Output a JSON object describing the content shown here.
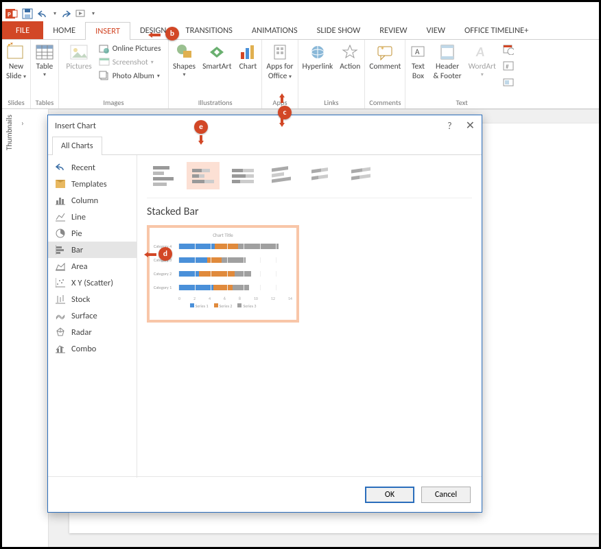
{
  "qat": {
    "save": "Save",
    "undo": "Undo",
    "redo": "Redo",
    "start": "Start"
  },
  "tabs": {
    "file": "FILE",
    "home": "HOME",
    "insert": "INSERT",
    "design": "DESIGN",
    "transitions": "TRANSITIONS",
    "animations": "ANIMATIONS",
    "slideshow": "SLIDE SHOW",
    "review": "REVIEW",
    "view": "VIEW",
    "timeline": "OFFICE TIMELINE+"
  },
  "ribbon": {
    "new_slide": "New\nSlide",
    "new_slide_l1": "New",
    "new_slide_l2": "Slide",
    "slides": "Slides",
    "table": "Table",
    "tables": "Tables",
    "pictures": "Pictures",
    "online": "Online Pictures",
    "screenshot": "Screenshot",
    "photo": "Photo Album",
    "images": "Images",
    "shapes": "Shapes",
    "smartart": "SmartArt",
    "chart": "Chart",
    "illustrations": "Illustrations",
    "apps_l1": "Apps for",
    "apps_l2": "Office",
    "apps": "Apps",
    "hyperlink": "Hyperlink",
    "action": "Action",
    "links": "Links",
    "comment": "Comment",
    "comments": "Comments",
    "textbox_l1": "Text",
    "textbox_l2": "Box",
    "header_l1": "Header",
    "header_l2": "& Footer",
    "wordart": "WordArt",
    "text": "Text"
  },
  "thumbnails": "Thumbnails",
  "dialog": {
    "title": "Insert Chart",
    "help": "?",
    "tab": "All Charts",
    "nav": {
      "recent": "Recent",
      "templates": "Templates",
      "column": "Column",
      "line": "Line",
      "pie": "Pie",
      "bar": "Bar",
      "area": "Area",
      "xy": "X Y (Scatter)",
      "stock": "Stock",
      "surface": "Surface",
      "radar": "Radar",
      "combo": "Combo"
    },
    "preview_title": "Stacked Bar",
    "ok": "OK",
    "cancel": "Cancel"
  },
  "callouts": {
    "b": "b",
    "c": "c",
    "d": "d",
    "e": "e"
  },
  "chart_data": {
    "type": "bar",
    "title": "Chart Title",
    "categories": [
      "Category 4",
      "Category 3",
      "Category 2",
      "Category 1"
    ],
    "series": [
      {
        "name": "Series 1",
        "color": "#4a90d9",
        "values_top_to_bottom": [
          4.5,
          3.5,
          2.5,
          4.3
        ]
      },
      {
        "name": "Series 2",
        "color": "#e08a3c",
        "values_top_to_bottom": [
          2.8,
          1.8,
          4.4,
          2.4
        ]
      },
      {
        "name": "Series 3",
        "color": "#a0a0a0",
        "values_top_to_bottom": [
          5.0,
          3.0,
          2.0,
          2.0
        ]
      }
    ],
    "xlim": [
      0,
      14
    ],
    "ticks": [
      0,
      2,
      4,
      6,
      8,
      10,
      12,
      14
    ],
    "legend": [
      "Series 1",
      "Series 2",
      "Series 3"
    ]
  }
}
